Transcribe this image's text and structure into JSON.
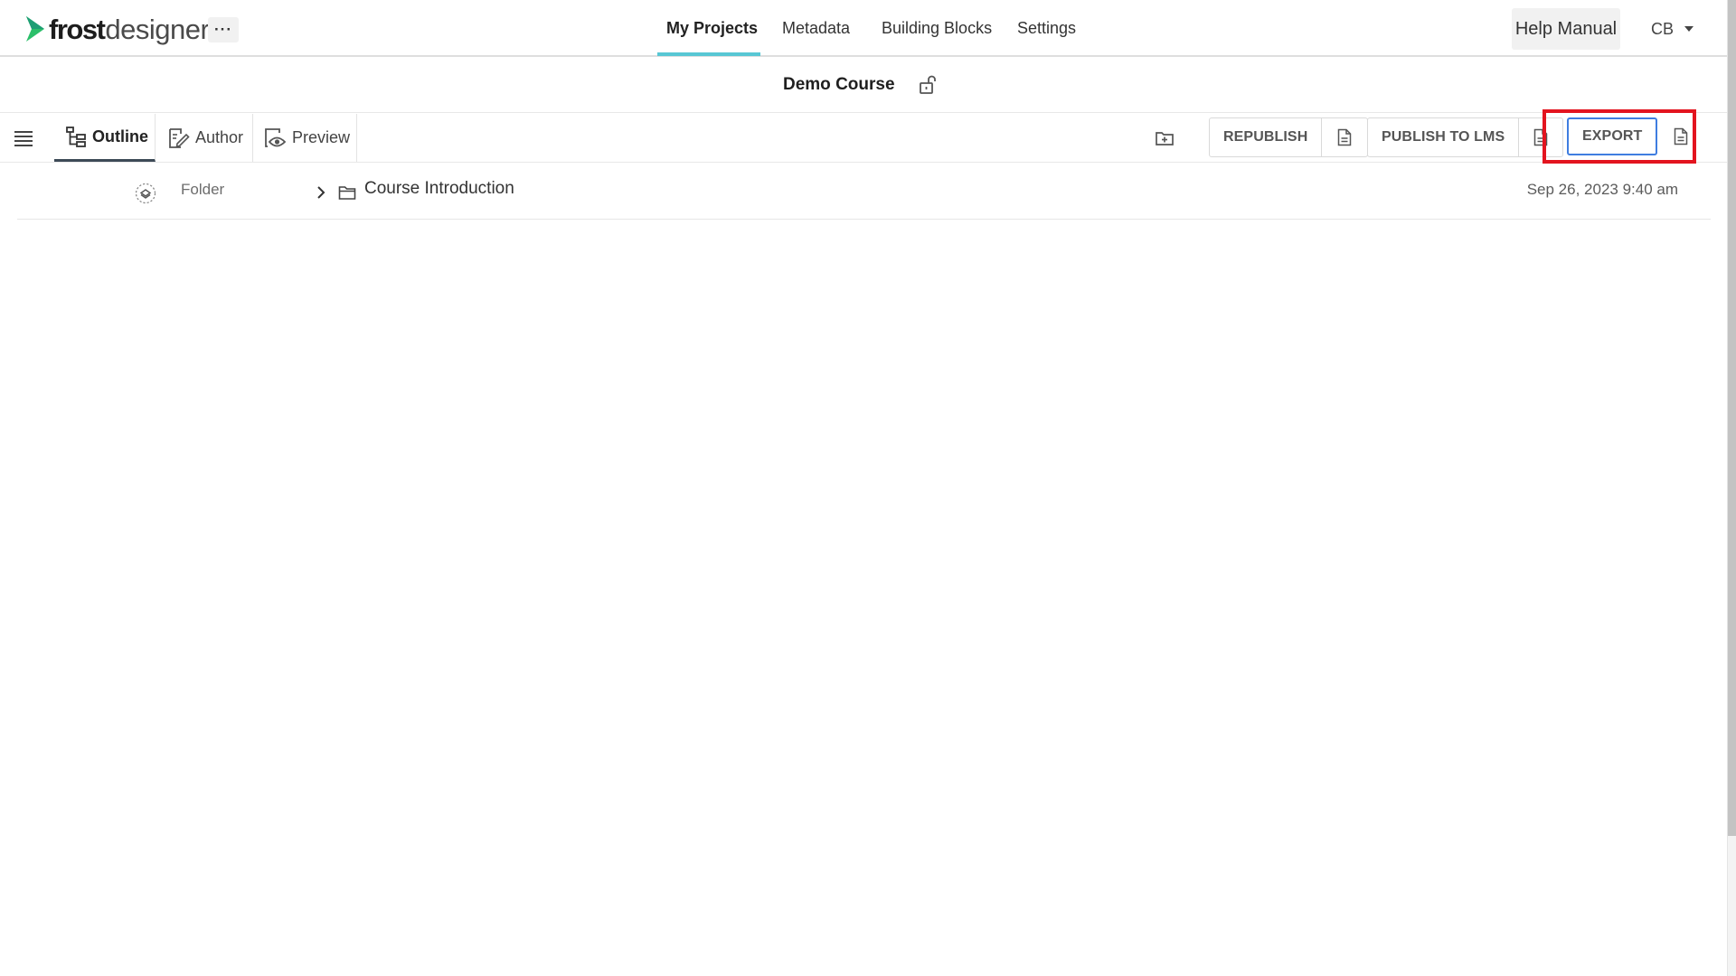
{
  "app": {
    "logo_strong": "frost",
    "logo_light": "designer",
    "more_label": "···",
    "accent_color": "#58c7d4",
    "logo_color": "#2bbf6a"
  },
  "nav": {
    "items": [
      {
        "label": "My Projects",
        "active": true
      },
      {
        "label": "Metadata",
        "active": false
      },
      {
        "label": "Building Blocks",
        "active": false
      },
      {
        "label": "Settings",
        "active": false
      }
    ],
    "help_label": "Help Manual",
    "user_initials": "CB"
  },
  "course": {
    "title": "Demo Course",
    "lock_icon": "unlock-icon"
  },
  "toolbar": {
    "tabs": [
      {
        "label": "Outline",
        "icon": "outline-tree-icon",
        "active": true
      },
      {
        "label": "Author",
        "icon": "edit-icon",
        "active": false
      },
      {
        "label": "Preview",
        "icon": "preview-eye-icon",
        "active": false
      }
    ],
    "republish_label": "REPUBLISH",
    "publish_lms_label": "PUBLISH TO LMS",
    "export_label": "EXPORT",
    "highlight_color": "#e3141f",
    "export_border_color": "#3f7de0"
  },
  "outline": {
    "rows": [
      {
        "type": "Folder",
        "title": "Course Introduction",
        "date": "Sep 26, 2023 9:40 am"
      }
    ]
  }
}
